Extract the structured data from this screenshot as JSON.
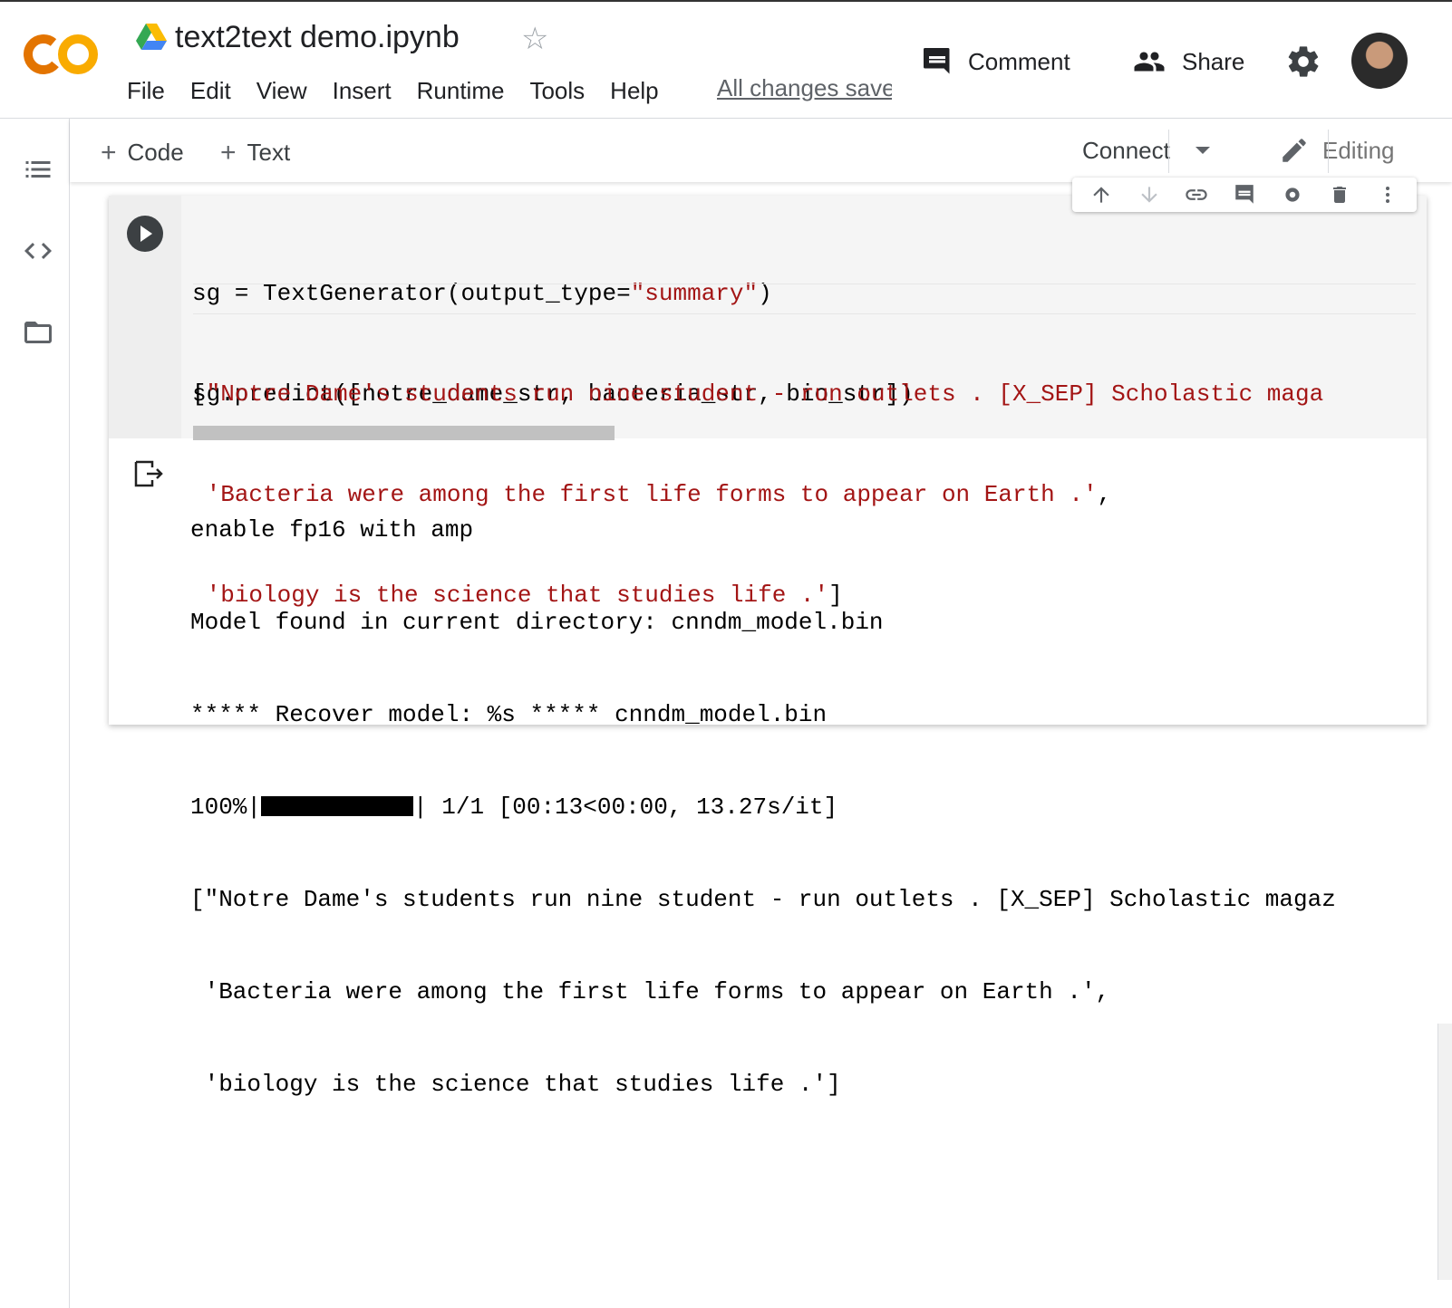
{
  "header": {
    "title": "text2text demo.ipynb",
    "logo_text": "CO",
    "menu": [
      "File",
      "Edit",
      "View",
      "Insert",
      "Runtime",
      "Tools",
      "Help"
    ],
    "save_status": "All changes saved",
    "comment_label": "Comment",
    "share_label": "Share",
    "icons": {
      "logo": "colab-logo",
      "drive": "google-drive-icon",
      "star": "star-outline-icon",
      "comment": "comment-icon",
      "share": "people-icon",
      "settings": "gear-icon",
      "avatar": "user-avatar"
    }
  },
  "toolbar": {
    "add_code_label": "Code",
    "add_text_label": "Text",
    "connect_label": "Connect",
    "editing_label": "Editing"
  },
  "sidebar": {
    "icons": [
      "table-of-contents-icon",
      "code-snippets-icon",
      "files-folder-icon"
    ]
  },
  "cell_toolbar": {
    "icons": [
      "move-up-icon",
      "move-down-icon",
      "link-icon",
      "comment-icon",
      "cell-settings-icon",
      "delete-icon",
      "more-vert-icon"
    ]
  },
  "cell": {
    "code_lines": [
      {
        "prefix": "sg = TextGenerator(output_type=",
        "str": "\"summary\"",
        "suffix": ")"
      },
      {
        "prefix": "sg.predict([notre_dame_str, bacteria_str, bio_str])",
        "str": "",
        "suffix": ""
      }
    ],
    "inline_output": [
      {
        "lead": "[",
        "text": "\"Notre Dame's students run nine student - run outlets . [X_SEP] Scholastic maga",
        "tail": ""
      },
      {
        "lead": " ",
        "text": "'Bacteria were among the first life forms to appear on Earth .'",
        "tail": ","
      },
      {
        "lead": " ",
        "text": "'biology is the science that studies life .'",
        "tail": "]"
      }
    ],
    "output_lines": [
      "enable fp16 with amp",
      "Model found in current directory: cnndm_model.bin",
      "***** Recover model: %s ***** cnndm_model.bin"
    ],
    "progress": {
      "percent_label": "100%",
      "fraction": 1.0,
      "stats": "| 1/1 [00:13<00:00, 13.27s/it]"
    },
    "output_result_lines": [
      "[\"Notre Dame's students run nine student - run outlets . [X_SEP] Scholastic magaz",
      " 'Bacteria were among the first life forms to appear on Earth .',",
      " 'biology is the science that studies life .']"
    ]
  },
  "colors": {
    "string": "#a31515",
    "logo_orange": "#f9ab00",
    "logo_amber": "#e37400"
  }
}
